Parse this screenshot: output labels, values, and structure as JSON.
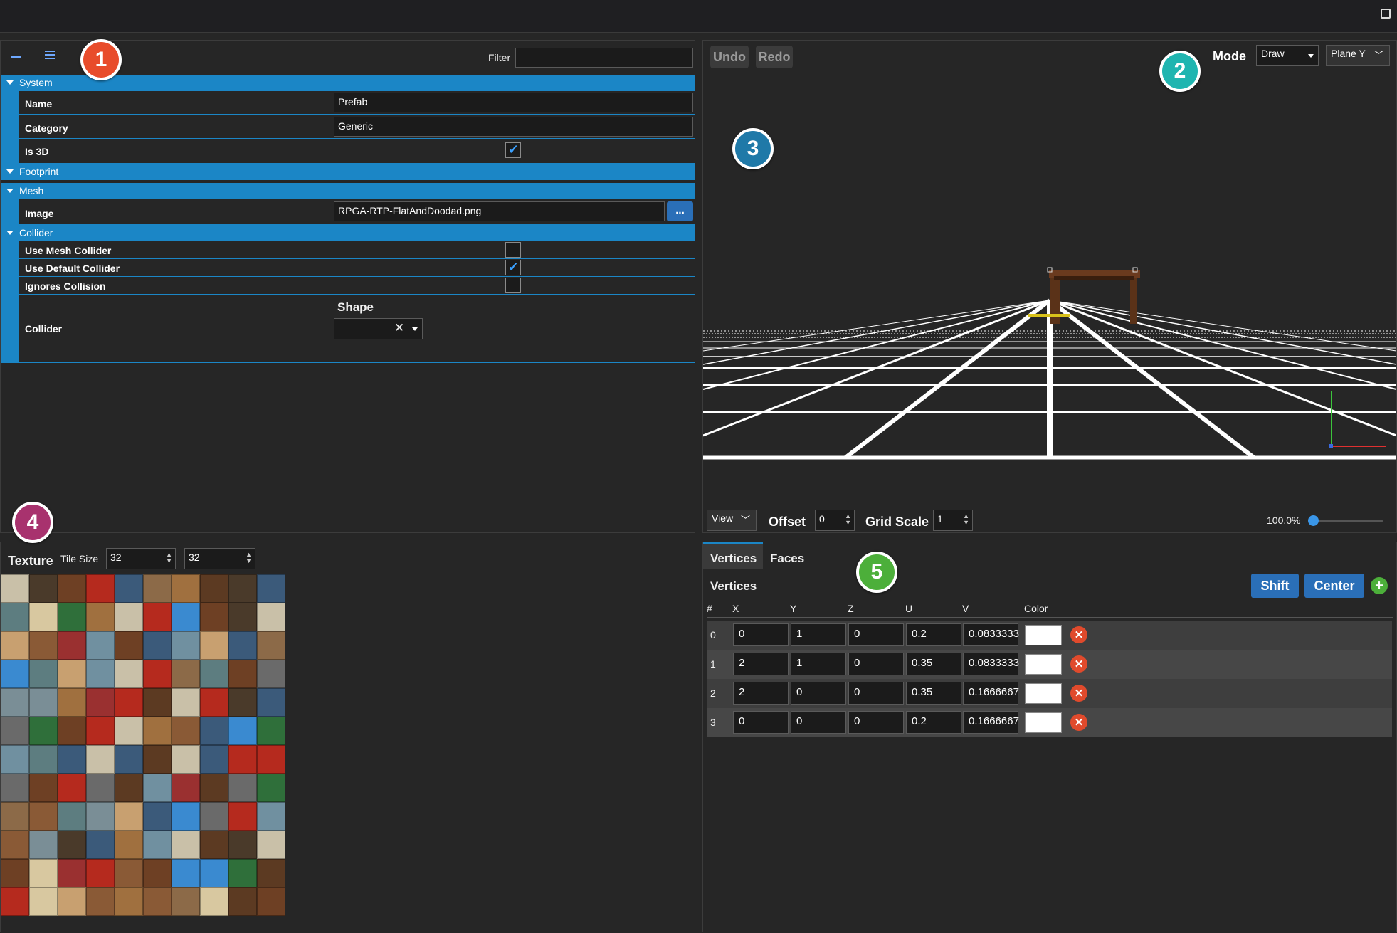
{
  "window": {
    "restore_icon": "restore-window-icon"
  },
  "badges": [
    "1",
    "2",
    "3",
    "4",
    "5"
  ],
  "properties": {
    "filter_label": "Filter",
    "filter_value": "",
    "sections": {
      "system": "System",
      "footprint": "Footprint",
      "mesh": "Mesh",
      "collider": "Collider"
    },
    "name": {
      "label": "Name",
      "value": "Prefab"
    },
    "category": {
      "label": "Category",
      "value": "Generic"
    },
    "is3d": {
      "label": "Is 3D",
      "checked": true
    },
    "image": {
      "label": "Image",
      "value": "RPGA-RTP-FlatAndDoodad.png",
      "browse_label": "..."
    },
    "use_mesh_collider": {
      "label": "Use Mesh Collider",
      "checked": false
    },
    "use_default_collider": {
      "label": "Use Default Collider",
      "checked": true
    },
    "ignores_collision": {
      "label": "Ignores Collision",
      "checked": false
    },
    "collider": {
      "label": "Collider",
      "shape_label": "Shape",
      "shape_value": "",
      "clear": "✕"
    }
  },
  "viewport": {
    "undo": "Undo",
    "redo": "Redo",
    "mode_label": "Mode",
    "mode_value": "Draw",
    "plane_value": "Plane Y",
    "view_label": "View",
    "offset_label": "Offset",
    "offset_value": "0",
    "grid_scale_label": "Grid Scale",
    "grid_scale_value": "1",
    "zoom": "100.0%",
    "zoom_fraction": 0.0
  },
  "texture": {
    "title": "Texture",
    "tile_size_label": "Tile Size",
    "tile_w": "32",
    "tile_h": "32"
  },
  "mesh": {
    "tabs": {
      "vertices": "Vertices",
      "faces": "Faces"
    },
    "section_title": "Vertices",
    "shift": "Shift",
    "center": "Center",
    "columns": [
      "#",
      "X",
      "Y",
      "Z",
      "U",
      "V",
      "Color"
    ],
    "vertices": [
      {
        "index": "0",
        "x": "0",
        "y": "1",
        "z": "0",
        "u": "0.2",
        "v": "0.0833333",
        "color": "#ffffff"
      },
      {
        "index": "1",
        "x": "2",
        "y": "1",
        "z": "0",
        "u": "0.35",
        "v": "0.0833333",
        "color": "#ffffff"
      },
      {
        "index": "2",
        "x": "2",
        "y": "0",
        "z": "0",
        "u": "0.35",
        "v": "0.1666667",
        "color": "#ffffff"
      },
      {
        "index": "3",
        "x": "0",
        "y": "0",
        "z": "0",
        "u": "0.2",
        "v": "0.1666667",
        "color": "#ffffff"
      }
    ]
  },
  "colors": {
    "accent": "#1b86c6",
    "badge1": "#e84c2b",
    "badge2": "#1fb5b0",
    "badge3": "#1f79a8",
    "badge4": "#a8326e",
    "badge5": "#4caf3a"
  }
}
